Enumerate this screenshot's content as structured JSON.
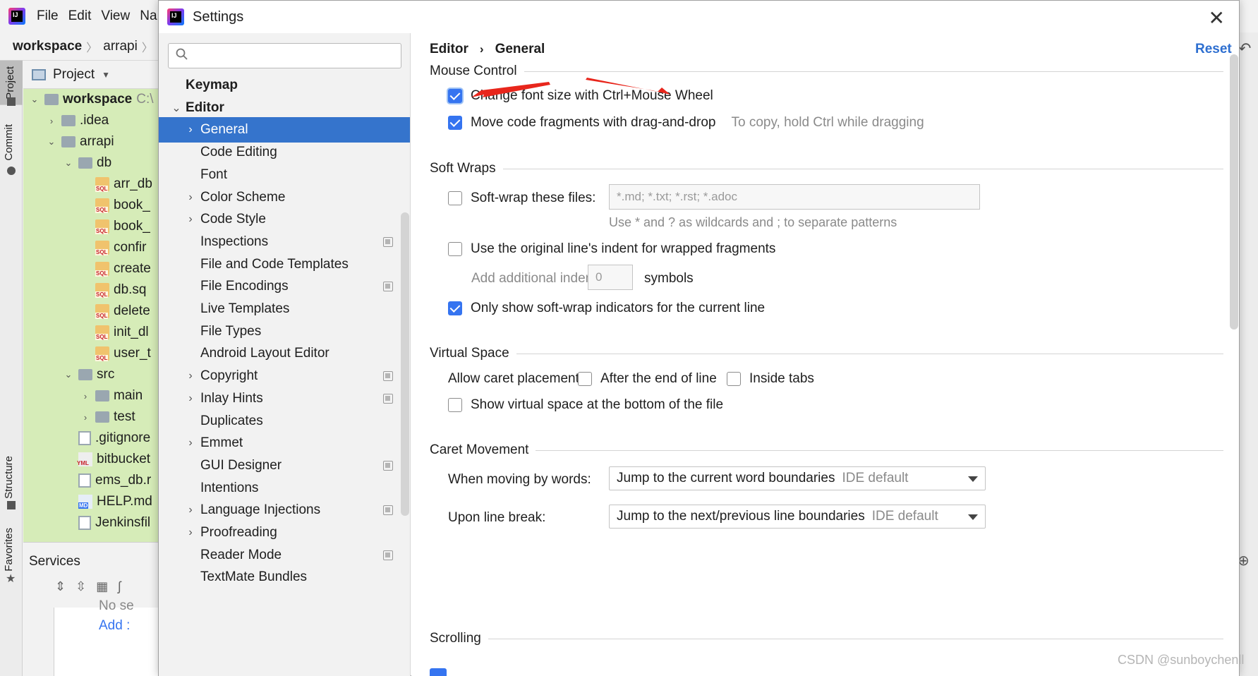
{
  "ide": {
    "menu": [
      "File",
      "Edit",
      "View",
      "Na"
    ],
    "breadcrumb": [
      "workspace",
      "arrapi"
    ],
    "left_tabs": [
      "Project",
      "Commit",
      "Structure",
      "Favorites"
    ],
    "project_panel": {
      "title": "Project",
      "tree": [
        {
          "label": "workspace",
          "path": "C:\\",
          "icon": "folder-icon",
          "indent": 0,
          "expanded": true,
          "bold": true
        },
        {
          "label": ".idea",
          "icon": "folder-icon",
          "indent": 1,
          "expanded": false
        },
        {
          "label": "arrapi",
          "icon": "folder-icon",
          "indent": 1,
          "expanded": true
        },
        {
          "label": "db",
          "icon": "folder-icon",
          "indent": 2,
          "expanded": true
        },
        {
          "label": "arr_db",
          "icon": "sql-icon",
          "indent": 3
        },
        {
          "label": "book_",
          "icon": "sql-icon",
          "indent": 3
        },
        {
          "label": "book_",
          "icon": "sql-icon",
          "indent": 3
        },
        {
          "label": "confir",
          "icon": "sql-icon",
          "indent": 3
        },
        {
          "label": "create",
          "icon": "sql-icon",
          "indent": 3
        },
        {
          "label": "db.sq",
          "icon": "sql-icon",
          "indent": 3
        },
        {
          "label": "delete",
          "icon": "sql-icon",
          "indent": 3
        },
        {
          "label": "init_dl",
          "icon": "sql-icon",
          "indent": 3
        },
        {
          "label": "user_t",
          "icon": "sql-icon",
          "indent": 3
        },
        {
          "label": "src",
          "icon": "folder-icon",
          "indent": 2,
          "expanded": true
        },
        {
          "label": "main",
          "icon": "folder-icon",
          "indent": 3,
          "expanded": false
        },
        {
          "label": "test",
          "icon": "folder-icon",
          "indent": 3,
          "expanded": false
        },
        {
          "label": ".gitignore",
          "icon": "file-icon",
          "indent": 2
        },
        {
          "label": "bitbucket",
          "icon": "yml-icon",
          "indent": 2
        },
        {
          "label": "ems_db.r",
          "icon": "file-icon",
          "indent": 2
        },
        {
          "label": "HELP.md",
          "icon": "md-icon",
          "indent": 2
        },
        {
          "label": "Jenkinsfil",
          "icon": "file-icon",
          "indent": 2
        }
      ]
    },
    "services": {
      "title": "Services",
      "empty_text": "No se",
      "add_link": "Add :"
    }
  },
  "dialog": {
    "title": "Settings",
    "search": {
      "placeholder": ""
    },
    "nav": [
      {
        "label": "Keymap",
        "level": 0,
        "bold": true
      },
      {
        "label": "Editor",
        "level": 0,
        "bold": true,
        "expanded": true
      },
      {
        "label": "General",
        "level": 1,
        "has_children": true,
        "selected": true
      },
      {
        "label": "Code Editing",
        "level": 1
      },
      {
        "label": "Font",
        "level": 1
      },
      {
        "label": "Color Scheme",
        "level": 1,
        "has_children": true
      },
      {
        "label": "Code Style",
        "level": 1,
        "has_children": true
      },
      {
        "label": "Inspections",
        "level": 1,
        "project_icon": true
      },
      {
        "label": "File and Code Templates",
        "level": 1
      },
      {
        "label": "File Encodings",
        "level": 1,
        "project_icon": true
      },
      {
        "label": "Live Templates",
        "level": 1
      },
      {
        "label": "File Types",
        "level": 1
      },
      {
        "label": "Android Layout Editor",
        "level": 1
      },
      {
        "label": "Copyright",
        "level": 1,
        "has_children": true,
        "project_icon": true
      },
      {
        "label": "Inlay Hints",
        "level": 1,
        "has_children": true,
        "project_icon": true
      },
      {
        "label": "Duplicates",
        "level": 1
      },
      {
        "label": "Emmet",
        "level": 1,
        "has_children": true
      },
      {
        "label": "GUI Designer",
        "level": 1,
        "project_icon": true
      },
      {
        "label": "Intentions",
        "level": 1
      },
      {
        "label": "Language Injections",
        "level": 1,
        "has_children": true,
        "project_icon": true
      },
      {
        "label": "Proofreading",
        "level": 1,
        "has_children": true
      },
      {
        "label": "Reader Mode",
        "level": 1,
        "project_icon": true
      },
      {
        "label": "TextMate Bundles",
        "level": 1
      }
    ],
    "breadcrumb": {
      "parent": "Editor",
      "current": "General"
    },
    "reset_label": "Reset",
    "sections": {
      "mouse_control": {
        "title": "Mouse Control",
        "change_font_size": {
          "label": "Change font size with Ctrl+Mouse Wheel",
          "checked": true
        },
        "drag_drop": {
          "label": "Move code fragments with drag-and-drop",
          "checked": true,
          "hint": "To copy, hold Ctrl while dragging"
        }
      },
      "soft_wraps": {
        "title": "Soft Wraps",
        "soft_wrap_files": {
          "label": "Soft-wrap these files:",
          "checked": false,
          "value": "*.md; *.txt; *.rst; *.adoc",
          "hint": "Use * and ? as wildcards and ; to separate patterns"
        },
        "original_indent": {
          "label": "Use the original line's indent for wrapped fragments",
          "checked": false
        },
        "additional_indent": {
          "label": "Add additional indent:",
          "value": "0",
          "suffix": "symbols"
        },
        "indicators_current": {
          "label": "Only show soft-wrap indicators for the current line",
          "checked": true
        }
      },
      "virtual_space": {
        "title": "Virtual Space",
        "caret_label": "Allow caret placement:",
        "after_end": {
          "label": "After the end of line",
          "checked": false
        },
        "inside_tabs": {
          "label": "Inside tabs",
          "checked": false
        },
        "virtual_bottom": {
          "label": "Show virtual space at the bottom of the file",
          "checked": false
        }
      },
      "caret_movement": {
        "title": "Caret Movement",
        "moving_words": {
          "label": "When moving by words:",
          "value": "Jump to the current word boundaries",
          "default_tag": "IDE default"
        },
        "line_break": {
          "label": "Upon line break:",
          "value": "Jump to the next/previous line boundaries",
          "default_tag": "IDE default"
        }
      },
      "scrolling": {
        "title": "Scrolling"
      }
    }
  },
  "watermark": "CSDN @sunboychenll",
  "colors": {
    "accent": "#3574f0",
    "selection": "#3574cc",
    "tree_bg": "#d6ecb8",
    "arrow": "#e8261c"
  }
}
